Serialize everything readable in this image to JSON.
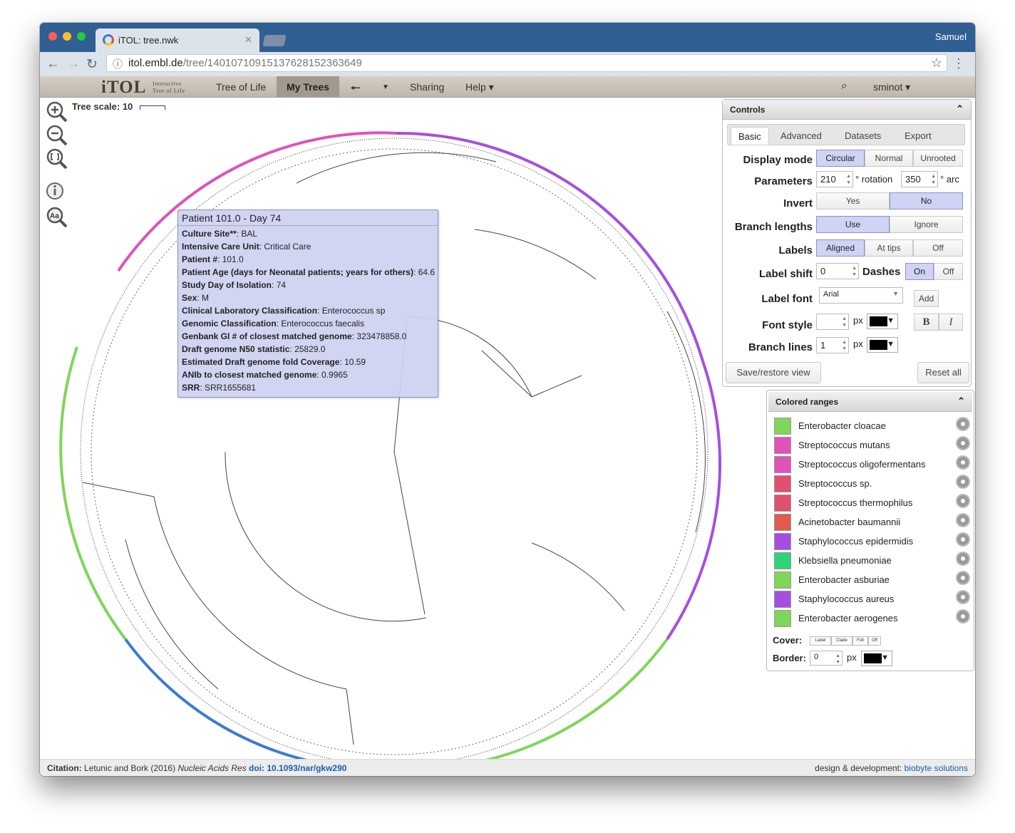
{
  "browser": {
    "tab_title": "iTOL: tree.nwk",
    "user_name": "Samuel",
    "url_domain": "itol.embl.de",
    "url_path": "/tree/14010710915137628152363649"
  },
  "app": {
    "logo_text": "iTOL",
    "logo_sub1": "Interactive",
    "logo_sub2": "Tree of Life",
    "menu": {
      "tree_of_life": "Tree of Life",
      "my_trees": "My Trees",
      "sharing": "Sharing",
      "help": "Help"
    },
    "username": "sminot"
  },
  "tree": {
    "scale_label": "Tree scale: 10"
  },
  "tooltip": {
    "title": "Patient 101.0 - Day 74",
    "rows": [
      {
        "k": "Culture Site**",
        "v": "BAL"
      },
      {
        "k": "Intensive Care Unit",
        "v": "Critical Care"
      },
      {
        "k": "Patient #",
        "v": "101.0"
      },
      {
        "k": "Patient Age (days for Neonatal patients; years for others)",
        "v": "64.6"
      },
      {
        "k": "Study Day of Isolation",
        "v": "74"
      },
      {
        "k": "Sex",
        "v": "M"
      },
      {
        "k": "Clinical Laboratory Classification",
        "v": "Enterococcus sp"
      },
      {
        "k": "Genomic Classification",
        "v": "Enterococcus faecalis"
      },
      {
        "k": "Genbank GI # of closest matched genome",
        "v": "323478858.0"
      },
      {
        "k": "Draft genome N50 statistic",
        "v": "25829.0"
      },
      {
        "k": "Estimated Draft genome fold Coverage",
        "v": "10.59"
      },
      {
        "k": "ANIb to closest matched genome",
        "v": "0.9965"
      },
      {
        "k": "SRR",
        "v": "SRR1655681"
      }
    ]
  },
  "controls": {
    "title": "Controls",
    "tabs": [
      "Basic",
      "Advanced",
      "Datasets",
      "Export"
    ],
    "display_mode": {
      "label": "Display mode",
      "options": [
        "Circular",
        "Normal",
        "Unrooted"
      ],
      "selected": "Circular"
    },
    "parameters": {
      "label": "Parameters",
      "rotation": "210",
      "rotation_suffix": "° rotation",
      "arc": "350",
      "arc_suffix": "° arc"
    },
    "invert": {
      "label": "Invert",
      "options": [
        "Yes",
        "No"
      ],
      "selected": "No"
    },
    "branch_lengths": {
      "label": "Branch lengths",
      "options": [
        "Use",
        "Ignore"
      ],
      "selected": "Use"
    },
    "labels": {
      "label": "Labels",
      "options": [
        "Aligned",
        "At tips",
        "Off"
      ],
      "selected": "Aligned"
    },
    "label_shift": {
      "label": "Label shift",
      "value": "0"
    },
    "dashes": {
      "label": "Dashes",
      "options": [
        "On",
        "Off"
      ],
      "selected": "On"
    },
    "label_font": {
      "label": "Label font",
      "value": "Arial",
      "add": "Add"
    },
    "font_style": {
      "label": "Font style",
      "px": "px",
      "bold": "B",
      "italic": "I"
    },
    "branch_lines": {
      "label": "Branch lines",
      "value": "1",
      "px": "px"
    },
    "save_restore": "Save/restore view",
    "reset_all": "Reset all"
  },
  "colored_ranges": {
    "title": "Colored ranges",
    "items": [
      {
        "name": "Enterobacter cloacae",
        "color": "#7fd65a"
      },
      {
        "name": "Streptococcus mutans",
        "color": "#e052b8"
      },
      {
        "name": "Streptococcus oligofermentans",
        "color": "#e052b8"
      },
      {
        "name": "Streptococcus sp.",
        "color": "#e0506f"
      },
      {
        "name": "Streptococcus thermophilus",
        "color": "#e0506f"
      },
      {
        "name": "Acinetobacter baumannii",
        "color": "#e25a4e"
      },
      {
        "name": "Staphylococcus epidermidis",
        "color": "#a54fe0"
      },
      {
        "name": "Klebsiella pneumoniae",
        "color": "#2fd47a"
      },
      {
        "name": "Enterobacter asburiae",
        "color": "#7fd65a"
      },
      {
        "name": "Staphylococcus aureus",
        "color": "#a54fe0"
      },
      {
        "name": "Enterobacter aerogenes",
        "color": "#7fd65a"
      }
    ],
    "cover_label": "Cover:",
    "cover_options": [
      "Label",
      "Clade",
      "Full",
      "Off"
    ],
    "border_label": "Border:",
    "border_value": "0",
    "px": "px"
  },
  "footer": {
    "citation_label": "Citation:",
    "citation_text": "Letunic and Bork (2016)",
    "journal": "Nucleic Acids Res",
    "doi": "doi: 10.1093/nar/gkw290",
    "design": "design & development:",
    "company": "biobyte solutions"
  }
}
